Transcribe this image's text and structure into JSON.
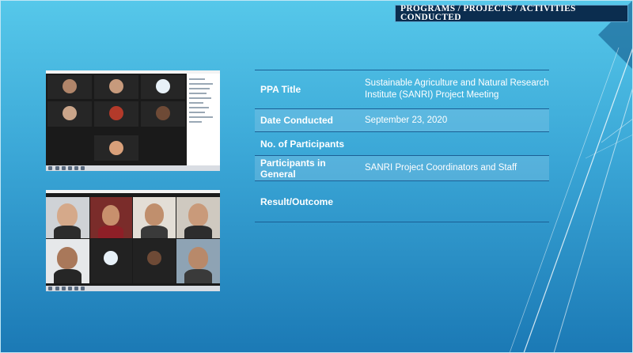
{
  "header": {
    "title": "PROGRAMS / PROJECTS / ACTIVITIES CONDUCTED"
  },
  "table": {
    "rows": [
      {
        "label": "PPA Title",
        "value": "Sustainable Agriculture and Natural Research Institute (SANRI) Project Meeting"
      },
      {
        "label": "Date Conducted",
        "value": "September 23, 2020"
      },
      {
        "label": "No. of Participants",
        "value": ""
      },
      {
        "label": "Participants in General",
        "value": "SANRI Project Coordinators and Staff"
      },
      {
        "label": "Result/Outcome",
        "value": ""
      }
    ]
  },
  "colors": {
    "header_bg": "#0b2d4f",
    "slide_top": "#56c8ea",
    "slide_bottom": "#1b79b5",
    "table_rule": "#1b5f95"
  }
}
